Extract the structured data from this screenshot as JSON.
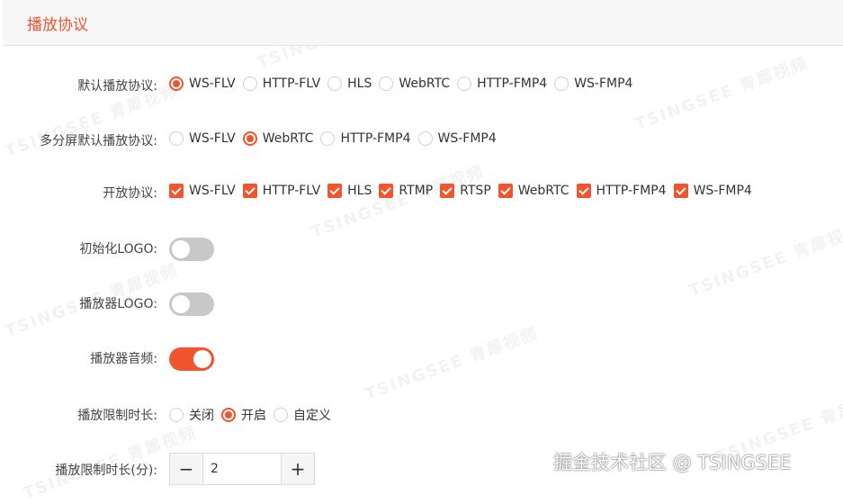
{
  "header": {
    "title": "播放协议"
  },
  "default_protocol": {
    "label": "默认播放协议:",
    "options": [
      "WS-FLV",
      "HTTP-FLV",
      "HLS",
      "WebRTC",
      "HTTP-FMP4",
      "WS-FMP4"
    ],
    "selected": "WS-FLV"
  },
  "multiscreen_protocol": {
    "label": "多分屏默认播放协议:",
    "options": [
      "WS-FLV",
      "WebRTC",
      "HTTP-FMP4",
      "WS-FMP4"
    ],
    "selected": "WebRTC"
  },
  "open_protocols": {
    "label": "开放协议:",
    "options": [
      "WS-FLV",
      "HTTP-FLV",
      "HLS",
      "RTMP",
      "RTSP",
      "WebRTC",
      "HTTP-FMP4",
      "WS-FMP4"
    ],
    "checked": [
      true,
      true,
      true,
      true,
      true,
      true,
      true,
      true
    ]
  },
  "init_logo": {
    "label": "初始化LOGO:",
    "on": false
  },
  "player_logo": {
    "label": "播放器LOGO:",
    "on": false
  },
  "player_audio": {
    "label": "播放器音频:",
    "on": true
  },
  "play_limit": {
    "label": "播放限制时长:",
    "options": [
      "关闭",
      "开启",
      "自定义"
    ],
    "selected": "开启"
  },
  "play_limit_minutes": {
    "label": "播放限制时长(分):",
    "value": "2",
    "minus": "−",
    "plus": "+"
  },
  "watermark": {
    "text": "TSINGSEE 青犀视频"
  },
  "footer": {
    "credit": "掘金技术社区 @ TSINGSEE"
  },
  "colors": {
    "accent": "#f0552e",
    "switch_off": "#c8c8c8"
  }
}
